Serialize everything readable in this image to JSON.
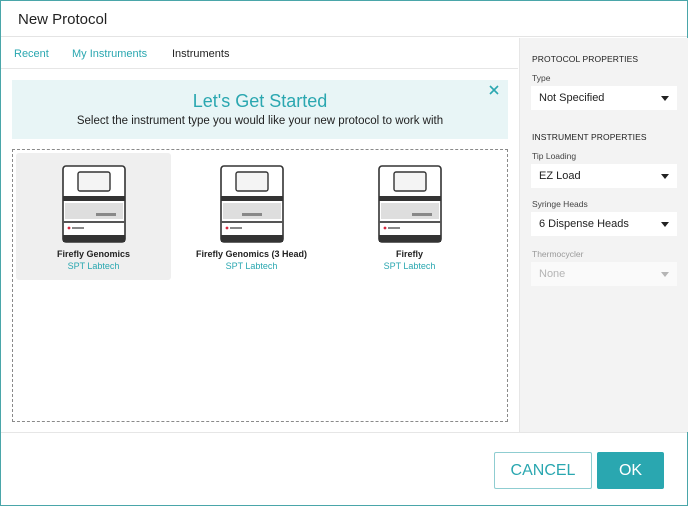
{
  "window": {
    "title": "New Protocol"
  },
  "tabs": [
    {
      "label": "Recent",
      "active": false
    },
    {
      "label": "My Instruments",
      "active": false
    },
    {
      "label": "Instruments",
      "active": true
    }
  ],
  "banner": {
    "headline": "Let's Get Started",
    "subtitle": "Select the instrument type you would like your new protocol to work with",
    "close_icon": "close-icon"
  },
  "instruments": [
    {
      "name": "Firefly Genomics",
      "maker": "SPT Labtech",
      "selected": true
    },
    {
      "name": "Firefly Genomics (3 Head)",
      "maker": "SPT Labtech",
      "selected": false
    },
    {
      "name": "Firefly",
      "maker": "SPT Labtech",
      "selected": false
    }
  ],
  "sidebar": {
    "protocol_heading": "PROTOCOL PROPERTIES",
    "type": {
      "label": "Type",
      "value": "Not Specified"
    },
    "instrument_heading": "INSTRUMENT PROPERTIES",
    "tip_loading": {
      "label": "Tip Loading",
      "value": "EZ Load"
    },
    "syringe_heads": {
      "label": "Syringe Heads",
      "value": "6 Dispense Heads"
    },
    "thermocycler": {
      "label": "Thermocycler",
      "value": "None",
      "disabled": true
    }
  },
  "footer": {
    "cancel_label": "CANCEL",
    "ok_label": "OK"
  },
  "colors": {
    "accent": "#2aa7b0",
    "banner_bg": "#e8f5f6",
    "sidebar_bg": "#f3f3f3",
    "selected_card": "#efefef"
  }
}
